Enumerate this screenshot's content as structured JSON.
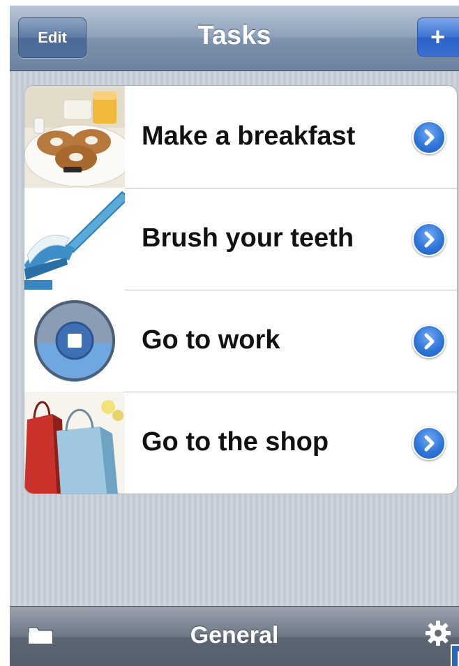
{
  "navbar": {
    "title": "Tasks",
    "edit_label": "Edit",
    "add_label": "+"
  },
  "tasks": [
    {
      "label": "Make a breakfast",
      "image": "breakfast-plate-image"
    },
    {
      "label": "Brush your teeth",
      "image": "toothbrush-image"
    },
    {
      "label": "Go to work",
      "image": "stop-button-image"
    },
    {
      "label": "Go to the shop",
      "image": "shopping-bags-image"
    }
  ],
  "toolbar": {
    "title": "General",
    "left_icon": "folder-icon",
    "right_icon": "gear-icon"
  },
  "colors": {
    "accent": "#2f76d8",
    "navbar": "#7d92ad",
    "toolbar": "#5c6673",
    "background": "#c8cfd8"
  }
}
